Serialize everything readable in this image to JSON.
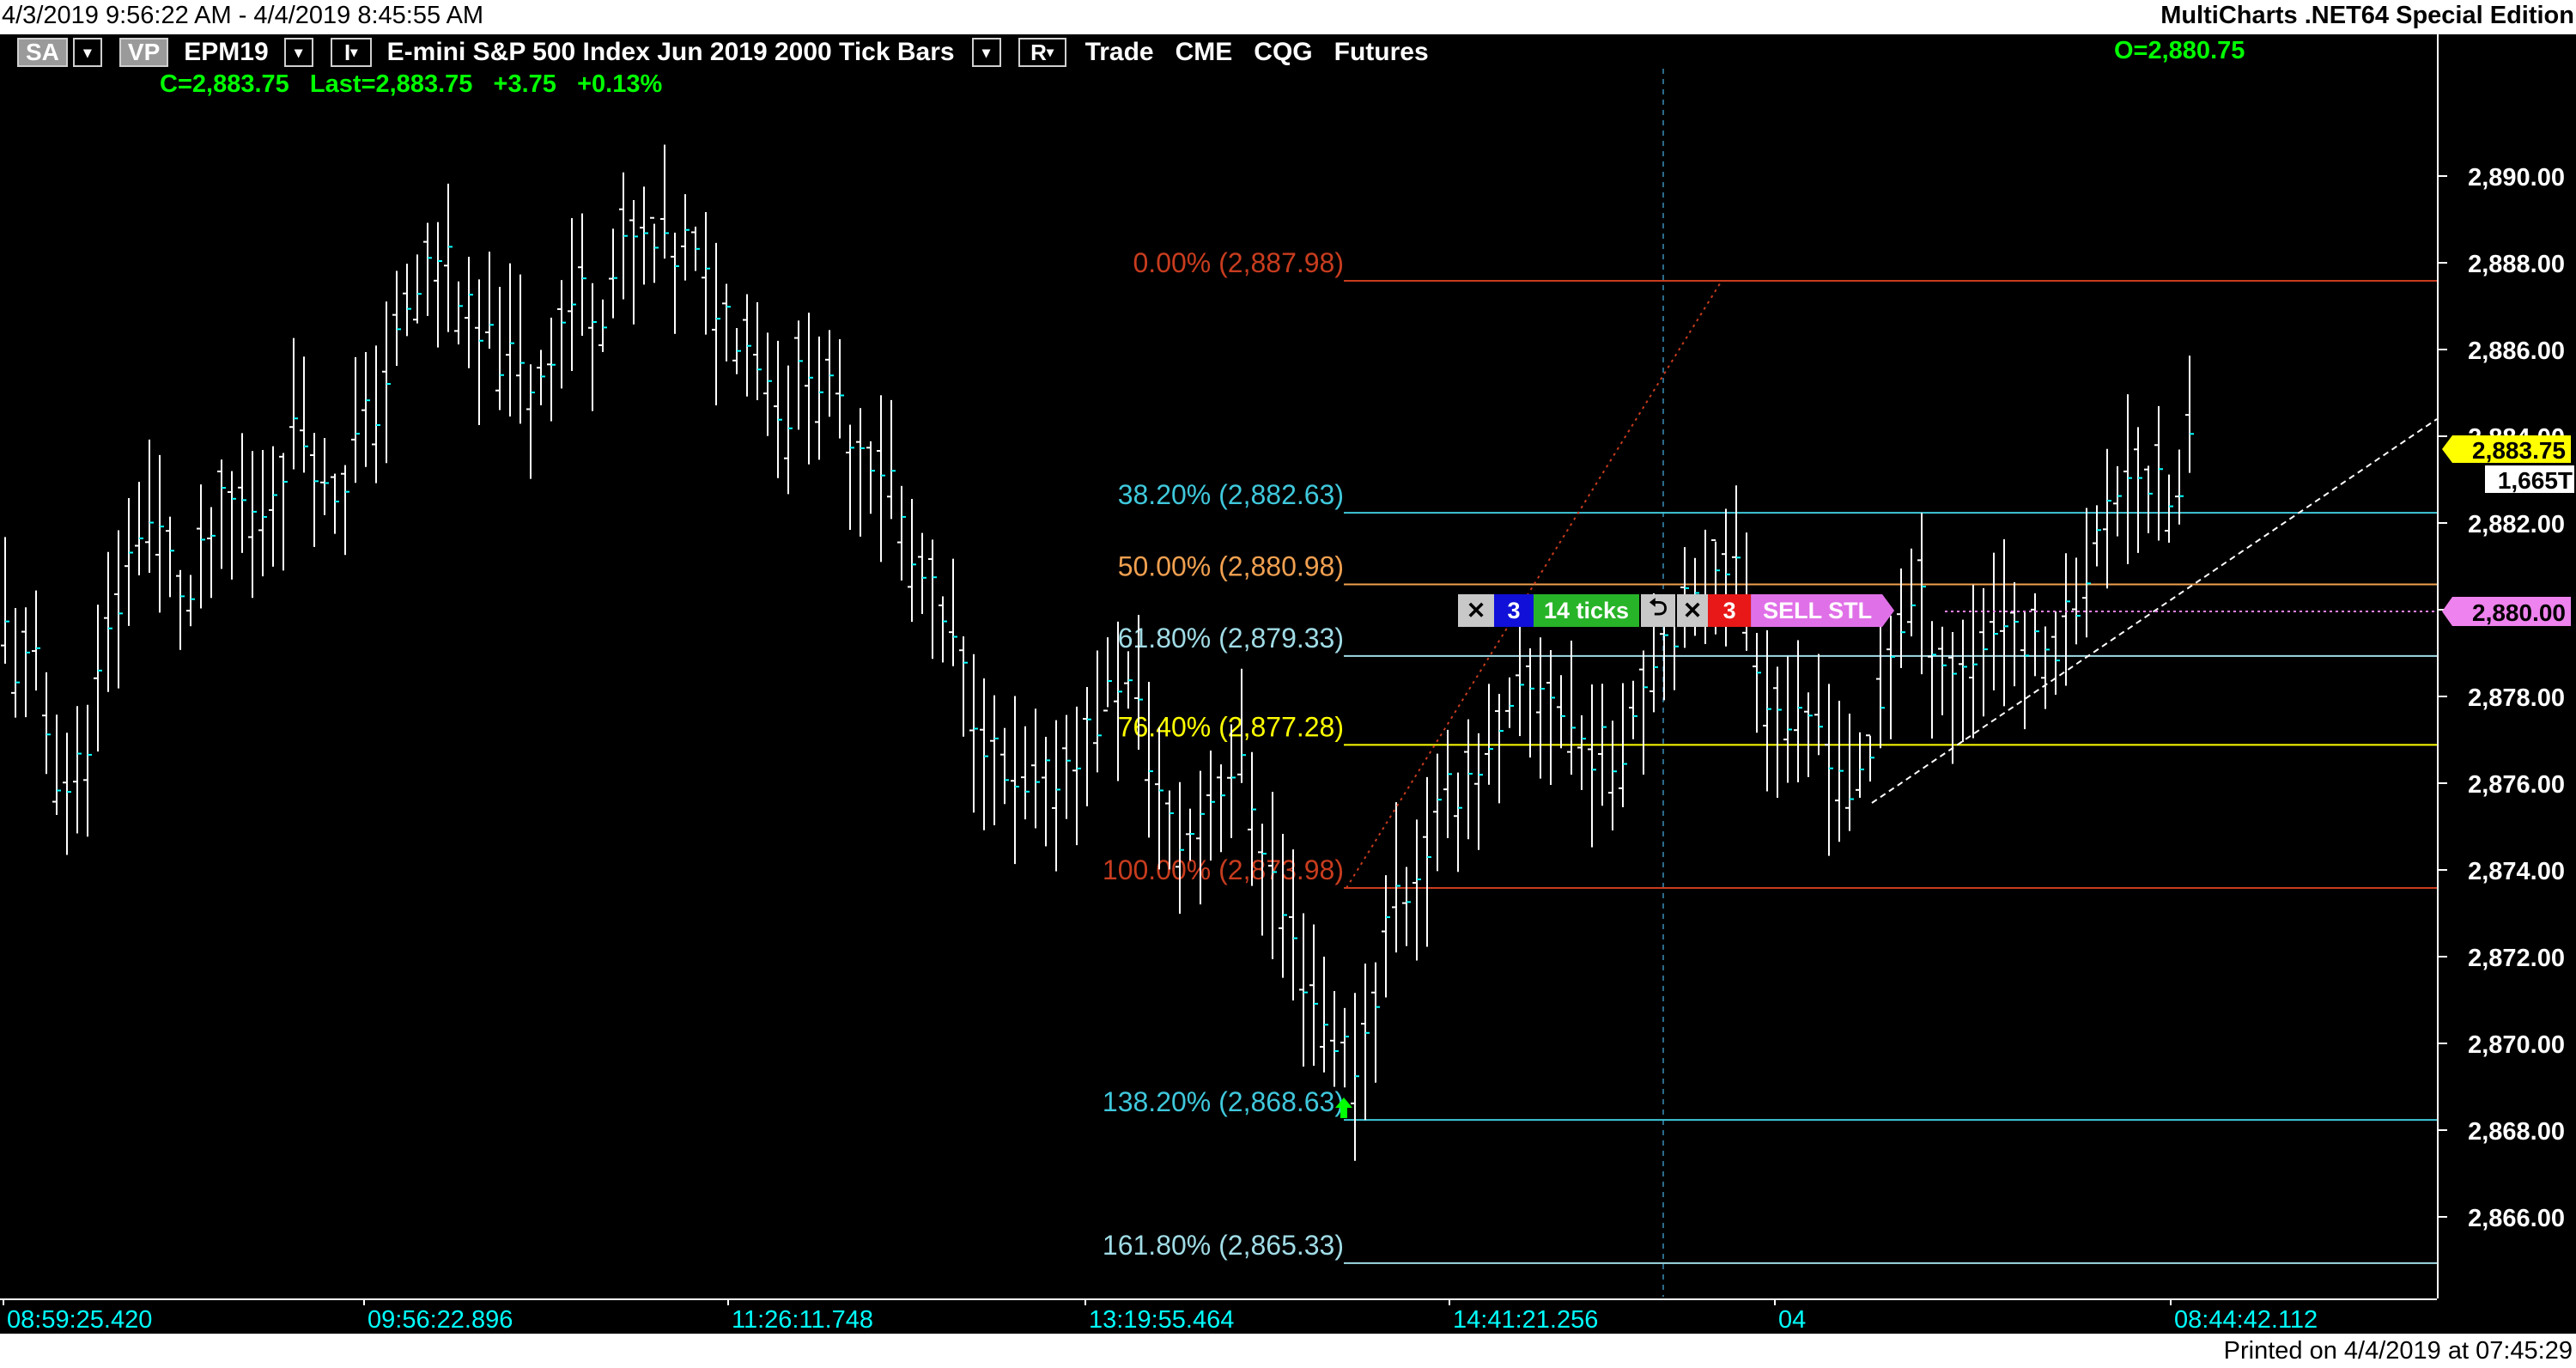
{
  "window": {
    "date_range": "4/3/2019 9:56:22 AM - 4/4/2019 8:45:55 AM",
    "app_title": "MultiCharts .NET64 Special Edition"
  },
  "toolbar": {
    "sa_label": "SA",
    "vp_label": "VP",
    "symbol": "EPM19",
    "interval_label": "I",
    "description": "E-mini S&P 500 Index Jun 2019  2000 Tick Bars",
    "r_label": "R",
    "meta": "Trade   CME   CQG   Futures",
    "dropdown_glyph": "▾"
  },
  "quote": {
    "line": "C=2,883.75   Last=2,883.75   +3.75   +0.13%",
    "open": "O=2,880.75"
  },
  "order_bar": {
    "cancel1_glyph": "✕",
    "qty_left": "3",
    "ticks": "14 ticks",
    "reverse_glyph": "⮌",
    "cancel2_glyph": "✕",
    "qty_right": "3",
    "order_label": "SELL STL"
  },
  "footer": {
    "printed": "Printed on 4/4/2019 at 07:45:29"
  },
  "colors": {
    "background": "#000000",
    "bars": "#ffffff",
    "bar_ticks": "#00ffff",
    "axis_text": "#ffffff",
    "time_text": "#00ffff",
    "quote_green": "#00ff00",
    "last_price_bg": "#ffff00",
    "order_price_bg": "#ee82ee"
  },
  "chart_data": {
    "type": "ohlc",
    "title": "E-mini S&P 500 Index Jun 2019  2000 Tick Bars",
    "y_range": [
      2864,
      2892
    ],
    "y_ticks": [
      "2,890.00",
      "2,888.00",
      "2,886.00",
      "2,884.00",
      "2,882.00",
      "2,880.00",
      "2,878.00",
      "2,876.00",
      "2,874.00",
      "2,872.00",
      "2,870.00",
      "2,868.00",
      "2,866.00"
    ],
    "x_labels": [
      "08:59:25.420",
      "09:56:22.896",
      "11:26:11.748",
      "13:19:55.464",
      "14:41:21.256",
      "04",
      "08:44:42.112"
    ],
    "last_price_label": "2,883.75",
    "volume_label": "1,665T",
    "order_price_label": "2,880.00",
    "fib_levels": [
      {
        "label": "0.00% (2,887.98)",
        "price": 2887.98,
        "color": "#c83c1e"
      },
      {
        "label": "38.20% (2,882.63)",
        "price": 2882.63,
        "color": "#3fc8dc"
      },
      {
        "label": "50.00% (2,880.98)",
        "price": 2880.98,
        "color": "#f0a050"
      },
      {
        "label": "61.80% (2,879.33)",
        "price": 2879.33,
        "color": "#a0dce6"
      },
      {
        "label": "76.40% (2,877.28)",
        "price": 2877.28,
        "color": "#ffff00"
      },
      {
        "label": "100.00% (2,873.98)",
        "price": 2873.98,
        "color": "#c83c1e"
      },
      {
        "label": "138.20% (2,868.63)",
        "price": 2868.63,
        "color": "#3fc8dc"
      },
      {
        "label": "161.80% (2,865.33)",
        "price": 2865.33,
        "color": "#a0dce6"
      }
    ],
    "price_path": [
      [
        0,
        2880.0
      ],
      [
        20,
        2878.5
      ],
      [
        40,
        2878.8
      ],
      [
        60,
        2876.5
      ],
      [
        80,
        2875.8
      ],
      [
        100,
        2877.0
      ],
      [
        120,
        2878.8
      ],
      [
        140,
        2880.3
      ],
      [
        160,
        2882.0
      ],
      [
        180,
        2882.0
      ],
      [
        200,
        2881.0
      ],
      [
        220,
        2880.0
      ],
      [
        240,
        2881.5
      ],
      [
        260,
        2882.3
      ],
      [
        280,
        2882.5
      ],
      [
        300,
        2882.0
      ],
      [
        320,
        2883.0
      ],
      [
        340,
        2884.0
      ],
      [
        360,
        2884.0
      ],
      [
        380,
        2882.5
      ],
      [
        400,
        2883.0
      ],
      [
        420,
        2884.2
      ],
      [
        440,
        2884.7
      ],
      [
        460,
        2886.0
      ],
      [
        480,
        2887.0
      ],
      [
        500,
        2888.0
      ],
      [
        520,
        2888.3
      ],
      [
        540,
        2887.0
      ],
      [
        560,
        2886.0
      ],
      [
        580,
        2886.0
      ],
      [
        600,
        2885.5
      ],
      [
        620,
        2885.2
      ],
      [
        640,
        2886.0
      ],
      [
        660,
        2887.0
      ],
      [
        680,
        2887.3
      ],
      [
        700,
        2887.0
      ],
      [
        720,
        2888.0
      ],
      [
        740,
        2888.5
      ],
      [
        760,
        2888.3
      ],
      [
        780,
        2888.0
      ],
      [
        800,
        2888.5
      ],
      [
        820,
        2887.5
      ],
      [
        840,
        2887.0
      ],
      [
        860,
        2886.5
      ],
      [
        880,
        2886.0
      ],
      [
        900,
        2885.0
      ],
      [
        920,
        2884.5
      ],
      [
        940,
        2886.0
      ],
      [
        960,
        2885.0
      ],
      [
        980,
        2884.5
      ],
      [
        1000,
        2884.0
      ],
      [
        1020,
        2883.5
      ],
      [
        1040,
        2883.0
      ],
      [
        1060,
        2881.0
      ],
      [
        1080,
        2880.5
      ],
      [
        1100,
        2879.5
      ],
      [
        1120,
        2878.5
      ],
      [
        1140,
        2877.5
      ],
      [
        1160,
        2876.5
      ],
      [
        1180,
        2875.5
      ],
      [
        1200,
        2875.5
      ],
      [
        1220,
        2876.0
      ],
      [
        1240,
        2876.5
      ],
      [
        1260,
        2877.0
      ],
      [
        1280,
        2877.5
      ],
      [
        1300,
        2878.5
      ],
      [
        1320,
        2878.0
      ],
      [
        1340,
        2876.5
      ],
      [
        1360,
        2875.0
      ],
      [
        1380,
        2874.5
      ],
      [
        1400,
        2875.5
      ],
      [
        1420,
        2876.0
      ],
      [
        1440,
        2876.5
      ],
      [
        1460,
        2875.5
      ],
      [
        1480,
        2874.0
      ],
      [
        1500,
        2872.5
      ],
      [
        1520,
        2871.5
      ],
      [
        1540,
        2870.5
      ],
      [
        1560,
        2870.0
      ],
      [
        1580,
        2869.5
      ],
      [
        1600,
        2871.0
      ],
      [
        1620,
        2873.5
      ],
      [
        1640,
        2873.5
      ],
      [
        1660,
        2874.5
      ],
      [
        1680,
        2875.5
      ],
      [
        1700,
        2876.0
      ],
      [
        1720,
        2876.5
      ],
      [
        1740,
        2876.5
      ],
      [
        1760,
        2877.5
      ],
      [
        1780,
        2878.0
      ],
      [
        1800,
        2878.5
      ],
      [
        1820,
        2877.5
      ],
      [
        1840,
        2877.0
      ],
      [
        1860,
        2876.8
      ],
      [
        1880,
        2876.5
      ],
      [
        1900,
        2877.5
      ],
      [
        1920,
        2879.0
      ],
      [
        1940,
        2879.5
      ],
      [
        1960,
        2880.0
      ],
      [
        1980,
        2880.0
      ],
      [
        2000,
        2881.5
      ],
      [
        2020,
        2881.0
      ],
      [
        2040,
        2879.5
      ],
      [
        2060,
        2878.0
      ],
      [
        2080,
        2877.5
      ],
      [
        2100,
        2877.0
      ],
      [
        2120,
        2877.3
      ],
      [
        2140,
        2876.5
      ],
      [
        2160,
        2875.5
      ],
      [
        2180,
        2876.5
      ],
      [
        2200,
        2879.0
      ],
      [
        2220,
        2880.0
      ],
      [
        2240,
        2880.0
      ],
      [
        2260,
        2879.0
      ],
      [
        2280,
        2878.5
      ],
      [
        2300,
        2879.0
      ],
      [
        2320,
        2879.5
      ],
      [
        2340,
        2880.0
      ],
      [
        2360,
        2879.0
      ],
      [
        2380,
        2879.0
      ],
      [
        2400,
        2879.5
      ],
      [
        2420,
        2880.5
      ],
      [
        2440,
        2881.5
      ],
      [
        2460,
        2882.5
      ],
      [
        2480,
        2883.5
      ],
      [
        2500,
        2883.0
      ],
      [
        2520,
        2882.5
      ],
      [
        2540,
        2882.5
      ],
      [
        2550,
        2883.75
      ]
    ]
  }
}
